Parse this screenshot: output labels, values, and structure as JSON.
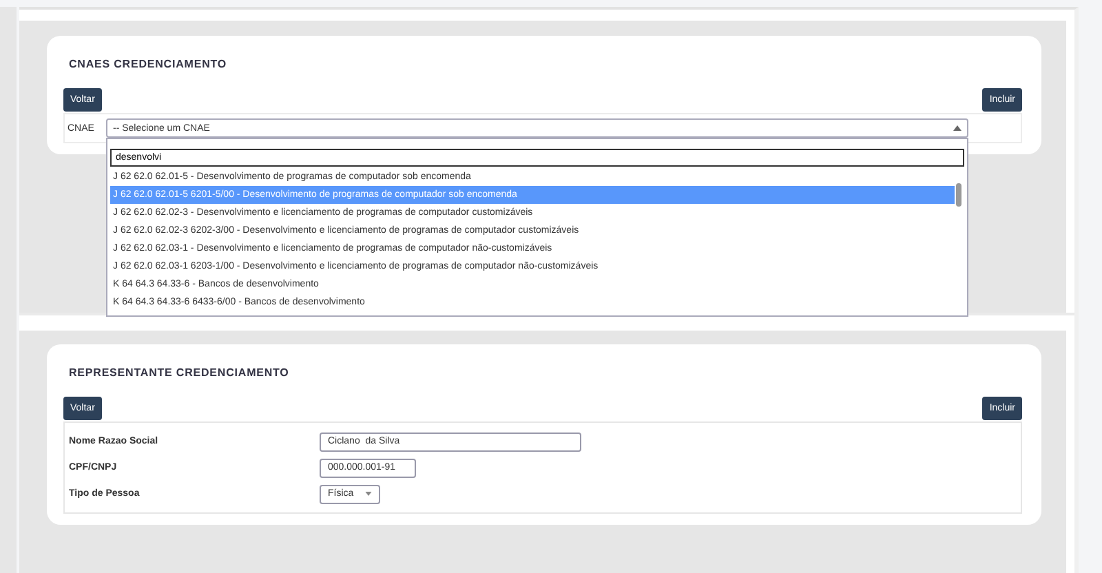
{
  "cnaes": {
    "title": "CNAES CREDENCIAMENTO",
    "back_button": "Voltar",
    "add_button": "Incluir",
    "field_label": "CNAE",
    "select_placeholder": "-- Selecione um CNAE",
    "dropdown": {
      "search_value": "desenvolvi",
      "options": [
        {
          "label": "J 62 62.0 62.01-5 - Desenvolvimento de programas de computador sob encomenda",
          "selected": false
        },
        {
          "label": "J 62 62.0 62.01-5 6201-5/00 - Desenvolvimento de programas de computador sob encomenda",
          "selected": true
        },
        {
          "label": "J 62 62.0 62.02-3 - Desenvolvimento e licenciamento de programas de computador customizáveis",
          "selected": false
        },
        {
          "label": "J 62 62.0 62.02-3 6202-3/00 - Desenvolvimento e licenciamento de programas de computador customizáveis",
          "selected": false
        },
        {
          "label": "J 62 62.0 62.03-1 - Desenvolvimento e licenciamento de programas de computador não-customizáveis",
          "selected": false
        },
        {
          "label": "J 62 62.0 62.03-1 6203-1/00 - Desenvolvimento e licenciamento de programas de computador não-customizáveis",
          "selected": false
        },
        {
          "label": "K 64 64.3 64.33-6 - Bancos de desenvolvimento",
          "selected": false
        },
        {
          "label": "K 64 64.3 64.33-6 6433-6/00 - Bancos de desenvolvimento",
          "selected": false
        }
      ]
    }
  },
  "representante": {
    "title": "REPRESENTANTE CREDENCIAMENTO",
    "back_button": "Voltar",
    "add_button": "Incluir",
    "fields": [
      {
        "label": "Nome Razao Social",
        "kind": "text",
        "value": "Ciclano  da Silva"
      },
      {
        "label": "CPF/CNPJ",
        "kind": "short",
        "value": "000.000.001-91"
      },
      {
        "label": "Tipo de Pessoa",
        "kind": "select",
        "value": "Física"
      }
    ]
  }
}
